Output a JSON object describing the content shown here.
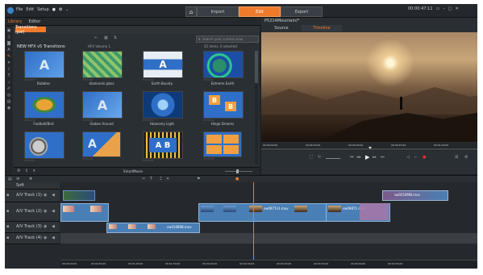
{
  "menu": {
    "items": [
      "File",
      "Edit",
      "Setup"
    ]
  },
  "top_tabs": {
    "home_icon": "home-icon",
    "import": "Import",
    "edit": "Edit",
    "export": "Export"
  },
  "window": {
    "timecode": "00:00:47:11"
  },
  "library": {
    "tabs": {
      "library": "Library",
      "editor": "Editor"
    },
    "sidebar_icons": [
      "media-icon",
      "music-icon",
      "photo-icon",
      "title-icon",
      "transition-icon",
      "effect-icon",
      "fx-icon",
      "text-icon",
      "audio-icon",
      "paint-icon",
      "compose-icon",
      "menu-icon",
      "dvd-icon"
    ],
    "active_category": "Transitions (pal)",
    "folder_title": "NEW HFX v5 Transitions",
    "collection": "HFX Volume 1",
    "items_count": "25 items, 0 selected",
    "search_placeholder": "Search your current view",
    "smartmovie": "SmartMovie",
    "thumbnails": [
      {
        "name": "Bubbles",
        "rating": "☆☆☆☆☆"
      },
      {
        "name": "diamonds glass",
        "rating": "☆☆☆☆☆"
      },
      {
        "name": "Earth Bounty",
        "rating": "☆☆☆☆☆"
      },
      {
        "name": "Extreme Earth",
        "rating": "☆☆☆☆☆"
      },
      {
        "name": "Football/Bird",
        "rating": "☆☆☆☆☆"
      },
      {
        "name": "Globes Around",
        "rating": "☆☆☆☆☆"
      },
      {
        "name": "Heavenly Light",
        "rating": "☆☆☆☆☆"
      },
      {
        "name": "Hinge Dreams",
        "rating": "☆☆☆☆☆"
      },
      {
        "name": "",
        "rating": "☆☆☆☆☆"
      },
      {
        "name": "",
        "rating": "☆☆☆☆☆"
      },
      {
        "name": "",
        "rating": "☆☆☆☆☆"
      },
      {
        "name": "",
        "rating": "☆☆☆☆☆"
      }
    ]
  },
  "player": {
    "title": "P5214Mountain/*",
    "tabs": {
      "source": "Source",
      "timeline": "Timeline"
    },
    "ruler_labels": [
      "00:00:00.00",
      "00:00:15.00",
      "00:00:30.00",
      "00:00:45.00",
      "00:01:00.00"
    ]
  },
  "timeline": {
    "tracks": [
      {
        "name": "Soft"
      },
      {
        "name": "A/V Track (1)"
      },
      {
        "name": "A/V Track (2)"
      },
      {
        "name": "A/V Track (3)"
      },
      {
        "name": "A/V Track (4)"
      }
    ],
    "clips": {
      "c1": "sw0254MN.mov",
      "c2": "sw0977n1.mov",
      "c3": "sw09871.mov",
      "c4": "sw010898.mov"
    },
    "ruler": [
      "00:00:00.00",
      "00:00:30.00",
      "00:01:00.00",
      "00:01:30.00",
      "00:02:00.00",
      "00:02:30.00",
      "00:03:00.00",
      "00:03:30.00",
      "00:04:00.00",
      "00:04:30.00"
    ]
  },
  "colors": {
    "accent": "#f07a2c",
    "clip": "#4a7fb5",
    "clip_pink": "#a878a8"
  }
}
